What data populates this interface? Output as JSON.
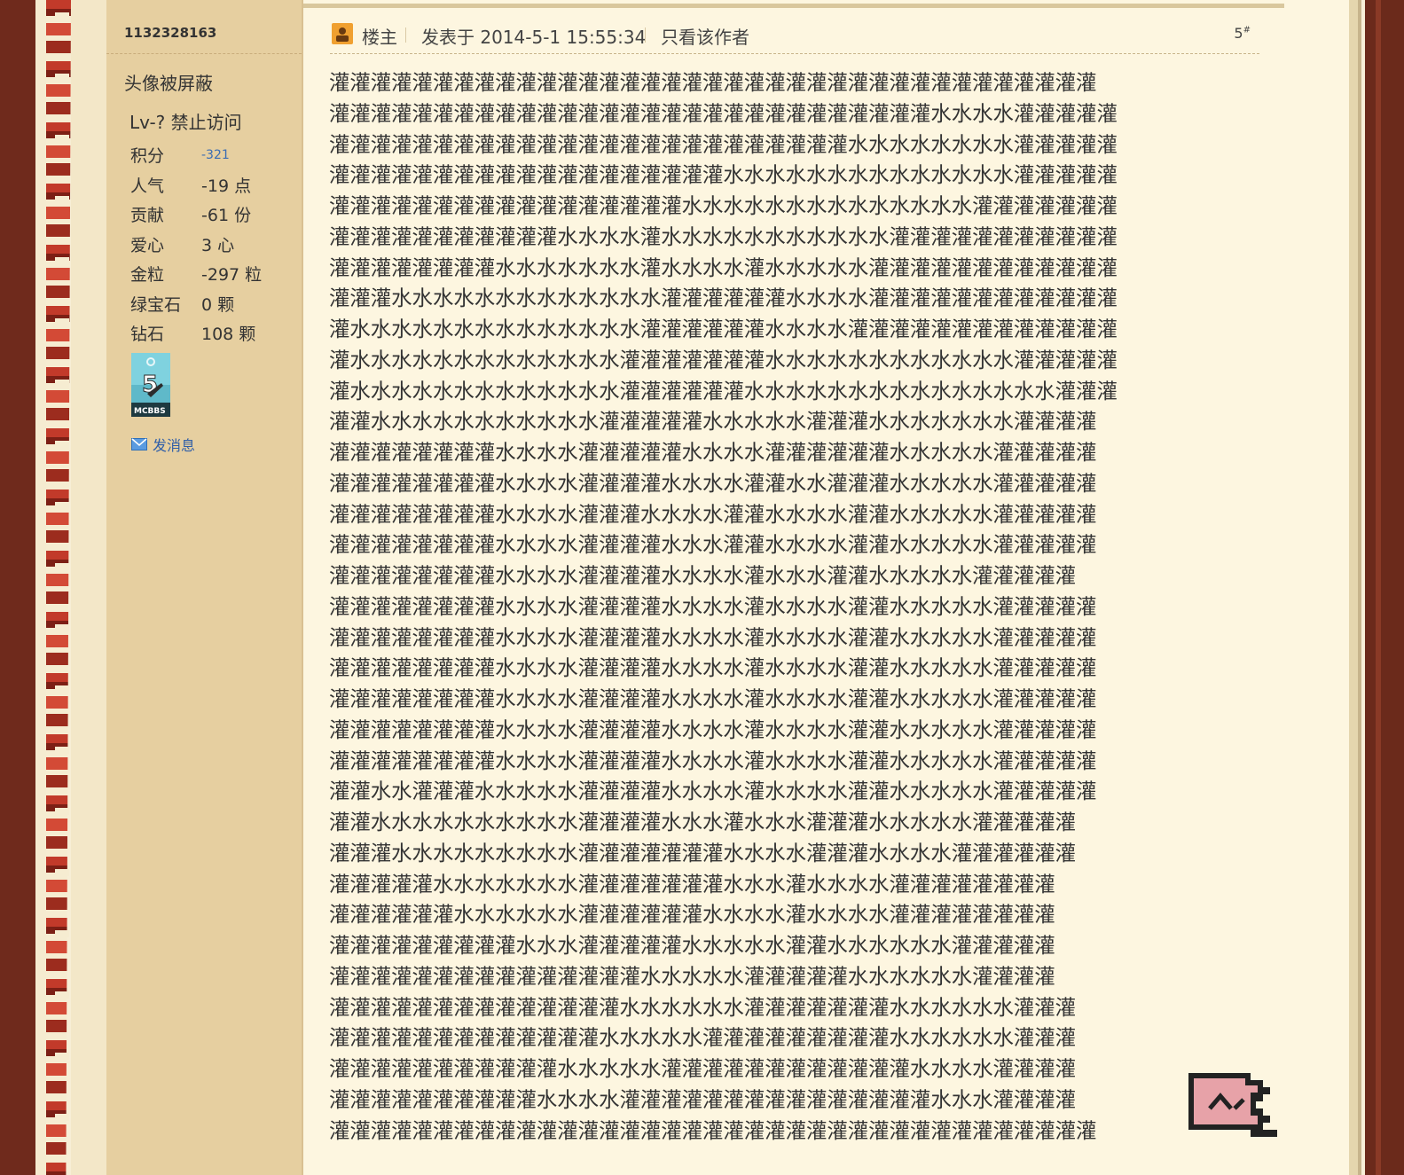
{
  "author": {
    "uid": "1132328163",
    "avatar_note": "头像被屏蔽",
    "level": "Lv-? 禁止访问",
    "stats": [
      {
        "key": "积分",
        "value": "-321",
        "small": true
      },
      {
        "key": "人气",
        "value": "-19 点"
      },
      {
        "key": "贡献",
        "value": "-61 份"
      },
      {
        "key": "爱心",
        "value": "3 心"
      },
      {
        "key": "金粒",
        "value": "-297 粒"
      },
      {
        "key": "绿宝石",
        "value": "0 颗"
      },
      {
        "key": "钻石",
        "value": "108 颗"
      }
    ],
    "medal_icon": "mcbbs-5th-anniversary-medal",
    "send_message": "发消息"
  },
  "post": {
    "author_label": "楼主",
    "posted_at": "发表于 2014-5-1 15:55:34",
    "only_author": "只看该作者",
    "floor": "5",
    "floor_mark": "#",
    "lines": [
      "灌灌灌灌灌灌灌灌灌灌灌灌灌灌灌灌灌灌灌灌灌灌灌灌灌灌灌灌灌灌灌灌灌灌灌灌灌",
      "灌灌灌灌灌灌灌灌灌灌灌灌灌灌灌灌灌灌灌灌灌灌灌灌灌灌灌灌灌水水水水灌灌灌灌灌",
      "灌灌灌灌灌灌灌灌灌灌灌灌灌灌灌灌灌灌灌灌灌灌灌灌灌水水水水水水水水灌灌灌灌灌",
      "灌灌灌灌灌灌灌灌灌灌灌灌灌灌灌灌灌灌灌水水水水水水水水水水水水水水灌灌灌灌灌",
      "灌灌灌灌灌灌灌灌灌灌灌灌灌灌灌灌灌水水水水水水水水水水水水水水灌灌灌灌灌灌灌",
      "灌灌灌灌灌灌灌灌灌灌灌水水水水灌水水水水水水水水水水水灌灌灌灌灌灌灌灌灌灌灌",
      "灌灌灌灌灌灌灌灌水水水水水水水灌水水水水灌水水水水水灌灌灌灌灌灌灌灌灌灌灌灌",
      "灌灌灌水水水水水水水水水水水水水灌灌灌灌灌灌水水水水灌灌灌灌灌灌灌灌灌灌灌灌",
      "灌水水水水水水水水水水水水水水灌灌灌灌灌灌水水水水灌灌灌灌灌灌灌灌灌灌灌灌灌",
      "灌水水水水水水水水水水水水水灌灌灌灌灌灌灌水水水水水水水水水水水水灌灌灌灌灌",
      "灌水水水水水水水水水水水水水灌灌灌灌灌灌水水水水水水水水水水水水水水水灌灌灌",
      "灌灌水水水水水水水水水水水灌灌灌灌灌水水水水水灌灌灌水水水水水水水灌灌灌灌",
      "灌灌灌灌灌灌灌灌水水水水灌灌灌灌灌水水水水灌灌灌灌灌灌水水水水水灌灌灌灌灌",
      "灌灌灌灌灌灌灌灌水水水水灌灌灌灌水水水水灌灌水水灌灌灌水水水水水灌灌灌灌灌",
      "灌灌灌灌灌灌灌灌水水水水灌灌灌水水水水灌灌水水水水灌灌水水水水水灌灌灌灌灌",
      "灌灌灌灌灌灌灌灌水水水水灌灌灌灌水水水灌灌水水水水灌灌水水水水水灌灌灌灌灌",
      "灌灌灌灌灌灌灌灌水水水水灌灌灌灌水水水水灌水水水灌灌水水水水水灌灌灌灌灌",
      "灌灌灌灌灌灌灌灌水水水水灌灌灌灌水水水水灌水水水水灌灌水水水水水灌灌灌灌灌",
      "灌灌灌灌灌灌灌灌水水水水灌灌灌灌水水水水灌水水水水灌灌水水水水水灌灌灌灌灌",
      "灌灌灌灌灌灌灌灌水水水水灌灌灌灌水水水水灌水水水水灌灌水水水水水灌灌灌灌灌",
      "灌灌灌灌灌灌灌灌水水水水灌灌灌灌水水水水灌水水水水灌灌水水水水水灌灌灌灌灌",
      "灌灌灌灌灌灌灌灌水水水水灌灌灌灌水水水水灌水水水水灌灌水水水水水灌灌灌灌灌",
      "灌灌灌灌灌灌灌灌水水水水灌灌灌灌水水水水灌水水水水灌灌水水水水水灌灌灌灌灌",
      "灌灌水水灌灌灌水水水水水灌灌灌灌水水水水灌水水水水灌灌水水水水水灌灌灌灌灌",
      "灌灌水水水水水水水水水水灌灌灌灌水水水灌水水水灌灌灌水水水水水灌灌灌灌灌",
      "灌灌灌水水水水水水水水水灌灌灌灌灌灌灌水水水水灌灌灌水水水水灌灌灌灌灌灌",
      "灌灌灌灌灌水水水水水水水灌灌灌灌灌灌灌水水水灌水水水水灌灌灌灌灌灌灌灌",
      "灌灌灌灌灌灌水水水水水水灌灌灌灌灌灌水水水水灌水水水水灌灌灌灌灌灌灌灌",
      "灌灌灌灌灌灌灌灌灌水水水灌灌灌灌灌水水水水水灌灌水水水水水水灌灌灌灌灌",
      "灌灌灌灌灌灌灌灌灌灌灌灌灌灌灌水水水水水灌灌灌灌灌水水水水水水灌灌灌灌",
      "灌灌灌灌灌灌灌灌灌灌灌灌灌灌水水水水水水灌灌灌灌灌灌灌水水水水水水灌灌灌",
      "灌灌灌灌灌灌灌灌灌灌灌灌灌水水水水水灌灌灌灌灌灌灌灌灌水水水水水水灌灌灌",
      "灌灌灌灌灌灌灌灌灌灌灌水水水水水灌灌灌灌灌灌灌灌灌灌灌灌水水水水灌灌灌灌",
      "灌灌灌灌灌灌灌灌灌灌水水水水灌灌灌灌灌灌灌灌灌灌灌灌灌灌灌水水水灌灌灌灌",
      "灌灌灌灌灌灌灌灌灌灌灌灌灌灌灌灌灌灌灌灌灌灌灌灌灌灌灌灌灌灌灌灌灌灌灌灌灌"
    ]
  },
  "icons": {
    "author_badge": "user-badge-icon",
    "mail": "mail-icon",
    "back_to_top": "back-to-top-icon"
  },
  "colors": {
    "sidebar_bg": "#e6cfa0",
    "page_bg": "#fdf6e0",
    "link": "#2f5ea8",
    "badge": "#f0a030"
  }
}
